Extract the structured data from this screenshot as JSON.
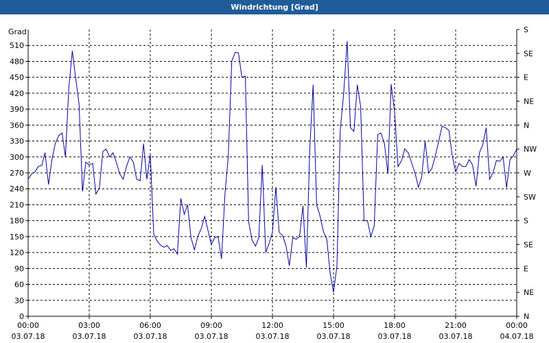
{
  "chart_data": {
    "type": "line",
    "title": "Windrichtung [Grad]",
    "ylabel": "Grad",
    "ylim": [
      0,
      540
    ],
    "grid": true,
    "y_ticks": [
      0,
      30,
      60,
      90,
      120,
      150,
      180,
      210,
      240,
      270,
      300,
      330,
      360,
      390,
      420,
      450,
      480,
      510
    ],
    "right_ticks": [
      {
        "value": 0,
        "label": "N"
      },
      {
        "value": 45,
        "label": "NE"
      },
      {
        "value": 90,
        "label": "E"
      },
      {
        "value": 135,
        "label": "SE"
      },
      {
        "value": 180,
        "label": "S"
      },
      {
        "value": 225,
        "label": "SW"
      },
      {
        "value": 270,
        "label": "W"
      },
      {
        "value": 315,
        "label": "NW"
      },
      {
        "value": 360,
        "label": "N"
      },
      {
        "value": 405,
        "label": "NE"
      },
      {
        "value": 450,
        "label": "E"
      },
      {
        "value": 495,
        "label": "SE"
      },
      {
        "value": 540,
        "label": "S"
      }
    ],
    "x_ticks": [
      {
        "hour": 0,
        "time": "00:00",
        "date": "03.07.18"
      },
      {
        "hour": 3,
        "time": "03:00",
        "date": "03.07.18"
      },
      {
        "hour": 6,
        "time": "06:00",
        "date": "03.07.18"
      },
      {
        "hour": 9,
        "time": "09:00",
        "date": "03.07.18"
      },
      {
        "hour": 12,
        "time": "12:00",
        "date": "03.07.18"
      },
      {
        "hour": 15,
        "time": "15:00",
        "date": "03.07.18"
      },
      {
        "hour": 18,
        "time": "18:00",
        "date": "03.07.18"
      },
      {
        "hour": 21,
        "time": "21:00",
        "date": "03.07.18"
      },
      {
        "hour": 24,
        "time": "00:00",
        "date": "04.07.18"
      }
    ],
    "xlim": [
      0,
      24
    ],
    "line_color": "#0000a0",
    "series": [
      {
        "points": [
          [
            0.0,
            258
          ],
          [
            0.17,
            268
          ],
          [
            0.33,
            272
          ],
          [
            0.5,
            282
          ],
          [
            0.67,
            284
          ],
          [
            0.83,
            308
          ],
          [
            1.0,
            248
          ],
          [
            1.17,
            295
          ],
          [
            1.33,
            325
          ],
          [
            1.5,
            340
          ],
          [
            1.67,
            345
          ],
          [
            1.83,
            300
          ],
          [
            2.0,
            430
          ],
          [
            2.17,
            500
          ],
          [
            2.33,
            450
          ],
          [
            2.5,
            400
          ],
          [
            2.67,
            235
          ],
          [
            2.83,
            290
          ],
          [
            3.0,
            285
          ],
          [
            3.17,
            288
          ],
          [
            3.33,
            230
          ],
          [
            3.5,
            242
          ],
          [
            3.67,
            310
          ],
          [
            3.83,
            315
          ],
          [
            4.0,
            300
          ],
          [
            4.17,
            308
          ],
          [
            4.33,
            290
          ],
          [
            4.5,
            268
          ],
          [
            4.67,
            258
          ],
          [
            4.83,
            282
          ],
          [
            5.0,
            300
          ],
          [
            5.17,
            290
          ],
          [
            5.33,
            258
          ],
          [
            5.5,
            255
          ],
          [
            5.67,
            325
          ],
          [
            5.83,
            258
          ],
          [
            6.0,
            305
          ],
          [
            6.17,
            155
          ],
          [
            6.33,
            142
          ],
          [
            6.5,
            134
          ],
          [
            6.67,
            130
          ],
          [
            6.83,
            133
          ],
          [
            7.0,
            124
          ],
          [
            7.17,
            127
          ],
          [
            7.33,
            117
          ],
          [
            7.5,
            222
          ],
          [
            7.67,
            192
          ],
          [
            7.83,
            210
          ],
          [
            8.0,
            148
          ],
          [
            8.17,
            125
          ],
          [
            8.33,
            150
          ],
          [
            8.5,
            165
          ],
          [
            8.67,
            188
          ],
          [
            8.83,
            162
          ],
          [
            9.0,
            135
          ],
          [
            9.17,
            148
          ],
          [
            9.33,
            150
          ],
          [
            9.5,
            108
          ],
          [
            9.67,
            232
          ],
          [
            9.83,
            300
          ],
          [
            10.0,
            480
          ],
          [
            10.17,
            497
          ],
          [
            10.33,
            496
          ],
          [
            10.5,
            450
          ],
          [
            10.67,
            452
          ],
          [
            10.83,
            178
          ],
          [
            11.0,
            143
          ],
          [
            11.17,
            132
          ],
          [
            11.33,
            148
          ],
          [
            11.5,
            285
          ],
          [
            11.67,
            120
          ],
          [
            11.83,
            137
          ],
          [
            12.0,
            158
          ],
          [
            12.17,
            243
          ],
          [
            12.33,
            158
          ],
          [
            12.5,
            152
          ],
          [
            12.67,
            132
          ],
          [
            12.83,
            95
          ],
          [
            13.0,
            148
          ],
          [
            13.17,
            145
          ],
          [
            13.33,
            150
          ],
          [
            13.5,
            208
          ],
          [
            13.67,
            92
          ],
          [
            13.83,
            312
          ],
          [
            14.0,
            436
          ],
          [
            14.17,
            210
          ],
          [
            14.33,
            190
          ],
          [
            14.5,
            160
          ],
          [
            14.67,
            145
          ],
          [
            14.83,
            82
          ],
          [
            15.0,
            45
          ],
          [
            15.17,
            95
          ],
          [
            15.33,
            350
          ],
          [
            15.5,
            420
          ],
          [
            15.67,
            518
          ],
          [
            15.83,
            355
          ],
          [
            16.0,
            348
          ],
          [
            16.17,
            436
          ],
          [
            16.33,
            395
          ],
          [
            16.5,
            180
          ],
          [
            16.67,
            180
          ],
          [
            16.83,
            150
          ],
          [
            17.0,
            170
          ],
          [
            17.17,
            342
          ],
          [
            17.33,
            345
          ],
          [
            17.5,
            325
          ],
          [
            17.67,
            268
          ],
          [
            17.83,
            437
          ],
          [
            18.0,
            385
          ],
          [
            18.17,
            282
          ],
          [
            18.33,
            292
          ],
          [
            18.5,
            315
          ],
          [
            18.67,
            308
          ],
          [
            18.83,
            290
          ],
          [
            19.0,
            270
          ],
          [
            19.17,
            243
          ],
          [
            19.33,
            262
          ],
          [
            19.5,
            330
          ],
          [
            19.67,
            270
          ],
          [
            19.83,
            278
          ],
          [
            20.0,
            302
          ],
          [
            20.17,
            330
          ],
          [
            20.33,
            358
          ],
          [
            20.5,
            355
          ],
          [
            20.67,
            350
          ],
          [
            20.83,
            302
          ],
          [
            21.0,
            272
          ],
          [
            21.17,
            288
          ],
          [
            21.33,
            282
          ],
          [
            21.5,
            282
          ],
          [
            21.67,
            295
          ],
          [
            21.83,
            285
          ],
          [
            22.0,
            245
          ],
          [
            22.17,
            308
          ],
          [
            22.33,
            323
          ],
          [
            22.5,
            355
          ],
          [
            22.67,
            258
          ],
          [
            22.83,
            270
          ],
          [
            23.0,
            293
          ],
          [
            23.17,
            292
          ],
          [
            23.33,
            300
          ],
          [
            23.5,
            242
          ],
          [
            23.67,
            295
          ],
          [
            23.83,
            302
          ],
          [
            24.0,
            315
          ]
        ]
      }
    ]
  }
}
